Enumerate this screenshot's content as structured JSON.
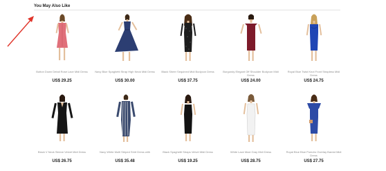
{
  "section": {
    "title": "You May Also Like"
  },
  "colors": {
    "annotation_arrow": "#e0352b",
    "price": "#222222",
    "name": "#8c8c8c"
  },
  "products": [
    {
      "name": "Button Down Detail Rose Lace Midi Dress",
      "price": "US$ 29.25",
      "dress_color": "#e0707a",
      "icon": "dress-pink-lace"
    },
    {
      "name": "Navy Blue Spaghetti Strap High Neck Midi Dress",
      "price": "US$ 30.00",
      "dress_color": "#2c3e72",
      "icon": "dress-navy-flared"
    },
    {
      "name": "Black Sheer Sequined Midi Bodycon Dress",
      "price": "US$ 37.75",
      "dress_color": "#1d1d1d",
      "icon": "dress-black-sequin"
    },
    {
      "name": "Burgundy Elegant Off Shoulder Bodycon Midi Dress",
      "price": "US$ 24.00",
      "dress_color": "#7d1a2a",
      "icon": "dress-burgundy-offshoulder"
    },
    {
      "name": "Royal Blue Twist Knot Front Strapless Midi Dress",
      "price": "US$ 24.75",
      "dress_color": "#1f46b5",
      "icon": "dress-royal-blue-strapless"
    },
    {
      "name": "Black V Neck Sleeve Velvet Midi Dress",
      "price": "US$ 26.75",
      "dress_color": "#161616",
      "icon": "dress-black-velvet"
    },
    {
      "name": "Navy White Multi Striped Shirt Dress with",
      "price": "US$ 35.48",
      "dress_color": "#3a4a6e",
      "icon": "dress-navy-striped-shirt"
    },
    {
      "name": "Black Spaghetti Straps Velvet Midi Dress",
      "price": "US$ 19.25",
      "dress_color": "#121212",
      "icon": "dress-black-straps"
    },
    {
      "name": "White Lace Maxi Gray Midi Dress",
      "price": "US$ 28.75",
      "dress_color": "#f2f2f2",
      "icon": "dress-white-lace"
    },
    {
      "name": "Royal Blue Blue Pomdro Overlay Bardot Midi Dress",
      "price": "US$ 27.75",
      "dress_color": "#2d4ba6",
      "icon": "dress-royal-blue-bardot"
    }
  ]
}
